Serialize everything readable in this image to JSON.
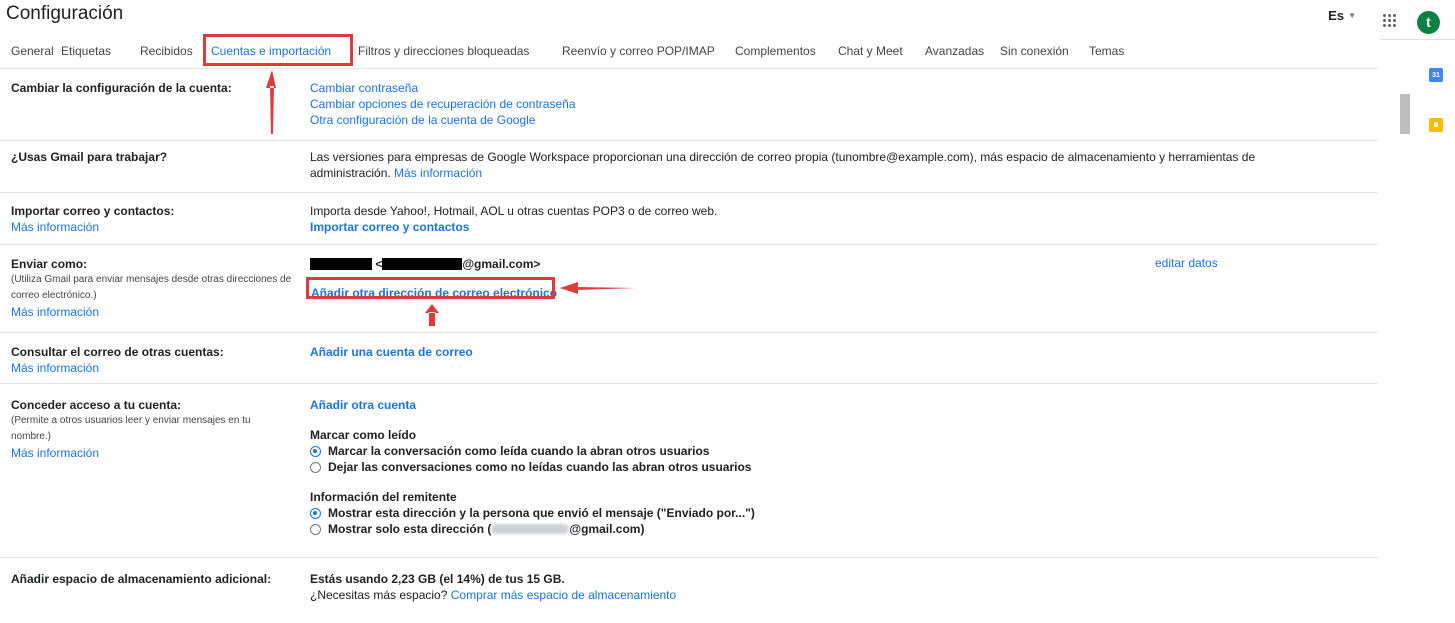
{
  "app": {
    "title": "Configuración",
    "language": "Es",
    "avatar_letter": "t"
  },
  "tabs": [
    {
      "label": "General"
    },
    {
      "label": "Etiquetas"
    },
    {
      "label": "Recibidos"
    },
    {
      "label": "Cuentas e importación",
      "active": true
    },
    {
      "label": "Filtros y direcciones bloqueadas"
    },
    {
      "label": "Reenvío y correo POP/IMAP"
    },
    {
      "label": "Complementos"
    },
    {
      "label": "Chat y Meet"
    },
    {
      "label": "Avanzadas"
    },
    {
      "label": "Sin conexión"
    },
    {
      "label": "Temas"
    }
  ],
  "sections": {
    "account": {
      "label": "Cambiar la configuración de la cuenta:",
      "links": [
        "Cambiar contraseña",
        "Cambiar opciones de recuperación de contraseña",
        "Otra configuración de la cuenta de Google"
      ]
    },
    "work": {
      "label": "¿Usas Gmail para trabajar?",
      "text": "Las versiones para empresas de Google Workspace proporcionan una dirección de correo propia (tunombre@example.com), más espacio de almacenamiento y herramientas de administración.",
      "link": "Más información"
    },
    "import": {
      "label": "Importar correo y contactos:",
      "learn_more": "Más información",
      "text": "Importa desde Yahoo!, Hotmail, AOL u otras cuentas POP3 o de correo web.",
      "action": "Importar correo y contactos"
    },
    "send_as": {
      "label": "Enviar como:",
      "note": "(Utiliza Gmail para enviar mensajes desde otras direcciones de correo electrónico.)",
      "learn_more": "Más información",
      "address_lt": "<",
      "address_suffix": "@gmail.com>",
      "edit": "editar datos",
      "add": "Añadir otra dirección de correo electrónico"
    },
    "check_mail": {
      "label": "Consultar el correo de otras cuentas:",
      "learn_more": "Más información",
      "action": "Añadir una cuenta de correo"
    },
    "grant": {
      "label": "Conceder acceso a tu cuenta:",
      "note": "(Permite a otros usuarios leer y enviar mensajes en tu nombre.)",
      "learn_more": "Más información",
      "action": "Añadir otra cuenta",
      "mark_read_title": "Marcar como leído",
      "mark_read_options": [
        {
          "label": "Marcar la conversación como leída cuando la abran otros usuarios",
          "checked": true
        },
        {
          "label": "Dejar las conversaciones como no leídas cuando las abran otros usuarios",
          "checked": false
        }
      ],
      "sender_title": "Información del remitente",
      "sender_options": [
        {
          "label": "Mostrar esta dirección y la persona que envió el mensaje (\"Enviado por...\")",
          "checked": true
        },
        {
          "label_prefix": "Mostrar solo esta dirección (",
          "label_suffix": "@gmail.com)",
          "checked": false
        }
      ]
    },
    "storage": {
      "label": "Añadir espacio de almacenamiento adicional:",
      "usage": "Estás usando 2,23 GB (el 14%) de tus 15 GB.",
      "question": "¿Necesitas más espacio?",
      "link": "Comprar más espacio de almacenamiento"
    }
  },
  "colors": {
    "accent": "#1a73e8",
    "annotation": "#e03a3a",
    "avatar": "#0b8043"
  }
}
